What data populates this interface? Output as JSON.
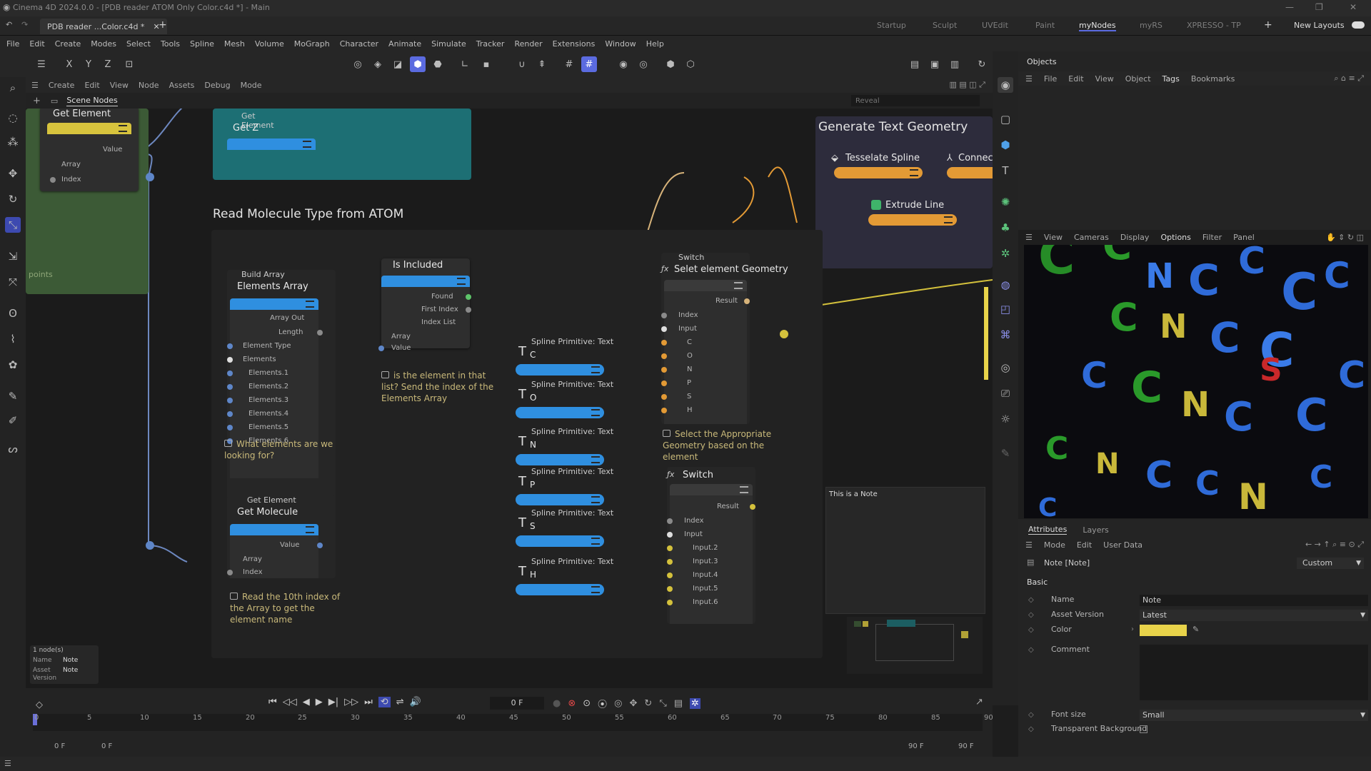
{
  "window": {
    "title": "Cinema 4D 2024.0.0 - [PDB reader ATOM Only Color.c4d *] - Main",
    "document_tab": "PDB reader ...Color.c4d *",
    "layouts": [
      "Startup",
      "Sculpt",
      "UVEdit",
      "Paint",
      "myNodes",
      "myRS",
      "XPRESSO - TP"
    ],
    "active_layout": "myNodes",
    "new_layouts": "New Layouts"
  },
  "menu": [
    "File",
    "Edit",
    "Create",
    "Modes",
    "Select",
    "Tools",
    "Spline",
    "Mesh",
    "Volume",
    "MoGraph",
    "Character",
    "Animate",
    "Simulate",
    "Tracker",
    "Render",
    "Extensions",
    "Window",
    "Help"
  ],
  "toolbar": {
    "axes": [
      "X",
      "Y",
      "Z"
    ]
  },
  "node_editor": {
    "menu": [
      "Create",
      "Edit",
      "View",
      "Node",
      "Assets",
      "Debug",
      "Mode"
    ],
    "tab": "Scene Nodes",
    "reveal_placeholder": "Reveal",
    "points_label": "points",
    "nodes": {
      "ge_left": {
        "title": "Get Element",
        "ports": [
          "Value",
          "Array",
          "Index"
        ]
      },
      "ge_z": {
        "sub": "Get Element",
        "title": "Get Z"
      },
      "build_array": {
        "sub": "Build Array",
        "title": "Elements Array",
        "ports": [
          "Array Out",
          "Length",
          "Element Type",
          "Elements",
          "Elements.1",
          "Elements.2",
          "Elements.3",
          "Elements.4",
          "Elements.5",
          "Elements.6"
        ]
      },
      "is_included": {
        "title": "Is Included",
        "ports": [
          "Found",
          "First Index",
          "Index List",
          "Array",
          "Value"
        ]
      },
      "get_molecule": {
        "sub": "Get Element",
        "title": "Get Molecule",
        "ports": [
          "Value",
          "Array",
          "Index"
        ]
      },
      "splines": [
        {
          "sub": "Spline Primitive: Text",
          "letter": "C"
        },
        {
          "sub": "Spline Primitive: Text",
          "letter": "O"
        },
        {
          "sub": "Spline Primitive: Text",
          "letter": "N"
        },
        {
          "sub": "Spline Primitive: Text",
          "letter": "P"
        },
        {
          "sub": "Spline Primitive: Text",
          "letter": "S"
        },
        {
          "sub": "Spline Primitive: Text",
          "letter": "H"
        }
      ],
      "switch1": {
        "sub": "Switch",
        "title": "Selet element Geometry",
        "ports": [
          "Result",
          "Index",
          "Input",
          "C",
          "O",
          "N",
          "P",
          "S",
          "H"
        ]
      },
      "switch2": {
        "title": "Switch",
        "ports": [
          "Result",
          "Index",
          "Input",
          "Input.2",
          "Input.3",
          "Input.4",
          "Input.5",
          "Input.6"
        ]
      },
      "tesselate": {
        "title": "Tesselate Spline"
      },
      "connect": {
        "title": "Connec"
      },
      "extrude": {
        "title": "Extrude Line"
      }
    },
    "groups": {
      "read_molecule": "Read Molecule Type from ATOM",
      "generate_text": "Generate Text Geometry"
    },
    "comments": {
      "what_elements": "What elements are we looking for?",
      "is_in_list": "is the element in that list? Send the index of the Elements Array",
      "select_geometry": "Select the Appropriate Geometry based on the element",
      "read_tenth": "Read the 10th index of the Array to get the element name"
    },
    "note_text": "This is a Note",
    "info_box": {
      "count": "1 node(s)",
      "name_label": "Name",
      "name_value": "Note",
      "asset_label": "Asset Version",
      "asset_value": "Note"
    }
  },
  "objects_panel": {
    "title": "Objects",
    "menu": [
      "File",
      "Edit",
      "View",
      "Object",
      "Tags",
      "Bookmarks"
    ]
  },
  "viewport_menu": [
    "View",
    "Cameras",
    "Display",
    "Options",
    "Filter",
    "Panel"
  ],
  "attributes": {
    "tabs": [
      "Attributes",
      "Layers"
    ],
    "menu": [
      "Mode",
      "Edit",
      "User Data"
    ],
    "object": "Note [Note]",
    "preset": "Custom",
    "section": "Basic",
    "rows": [
      {
        "label": "Name",
        "value": "Note"
      },
      {
        "label": "Asset Version",
        "value": "Latest"
      },
      {
        "label": "Color",
        "value": ""
      },
      {
        "label": "Comment",
        "value": ""
      },
      {
        "label": "Font size",
        "value": "Small"
      },
      {
        "label": "Transparent Background",
        "value": ""
      }
    ],
    "note_color": "#e8d34a"
  },
  "timeline": {
    "current_frame": "0 F",
    "ticks": [
      "0",
      "5",
      "10",
      "15",
      "20",
      "25",
      "30",
      "35",
      "40",
      "45",
      "50",
      "55",
      "60",
      "65",
      "70",
      "75",
      "80",
      "85",
      "90"
    ],
    "start_a": "0 F",
    "start_b": "0 F",
    "end_a": "90 F",
    "end_b": "90 F"
  },
  "colors": {
    "accent": "#5b6be0",
    "node_blue": "#2f8fe0",
    "node_yellow": "#d7c33d",
    "node_orange": "#e39a35",
    "group_teal": "#1d6f74"
  }
}
